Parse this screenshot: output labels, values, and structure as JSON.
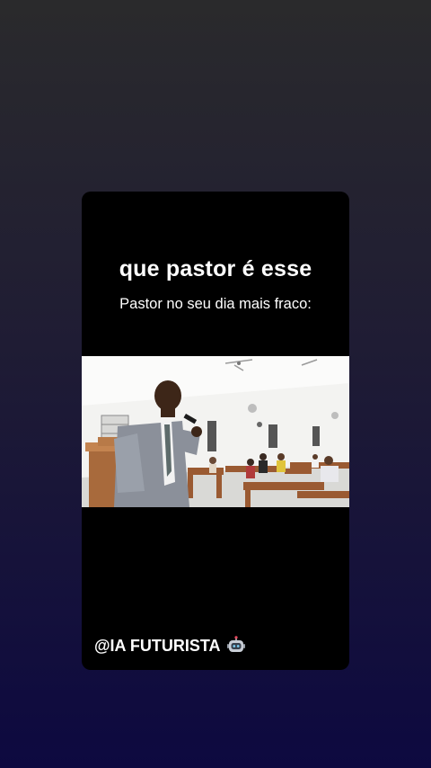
{
  "post": {
    "title": "que pastor é esse",
    "subtitle": "Pastor no seu dia mais fraco:",
    "watermark": "@IA FUTURISTA",
    "watermark_icon": "robot-icon"
  },
  "colors": {
    "background_top": "#2a2a2c",
    "background_bottom": "#0d0940",
    "card": "#000000",
    "text": "#ffffff"
  }
}
